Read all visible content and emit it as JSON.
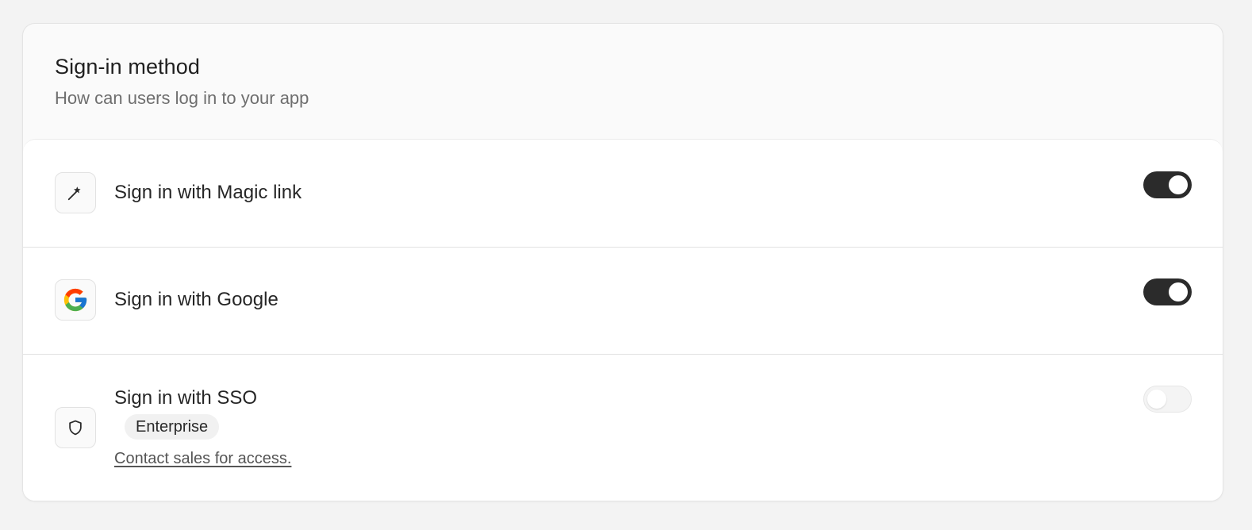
{
  "section": {
    "title": "Sign-in method",
    "subtitle": "How can users log in to your app"
  },
  "methods": [
    {
      "label": "Sign in with Magic link",
      "icon": "magic-wand-icon",
      "enabled": true
    },
    {
      "label": "Sign in with Google",
      "icon": "google-icon",
      "enabled": true
    },
    {
      "label": "Sign in with SSO",
      "icon": "shield-icon",
      "enabled": false,
      "badge": "Enterprise",
      "link": "Contact sales for access."
    }
  ],
  "colors": {
    "toggle_on": "#2b2b2b",
    "toggle_off": "#f4f4f4",
    "google_blue": "#4285F4",
    "google_red": "#EA4335",
    "google_yellow": "#FBBC05",
    "google_green": "#34A853"
  }
}
